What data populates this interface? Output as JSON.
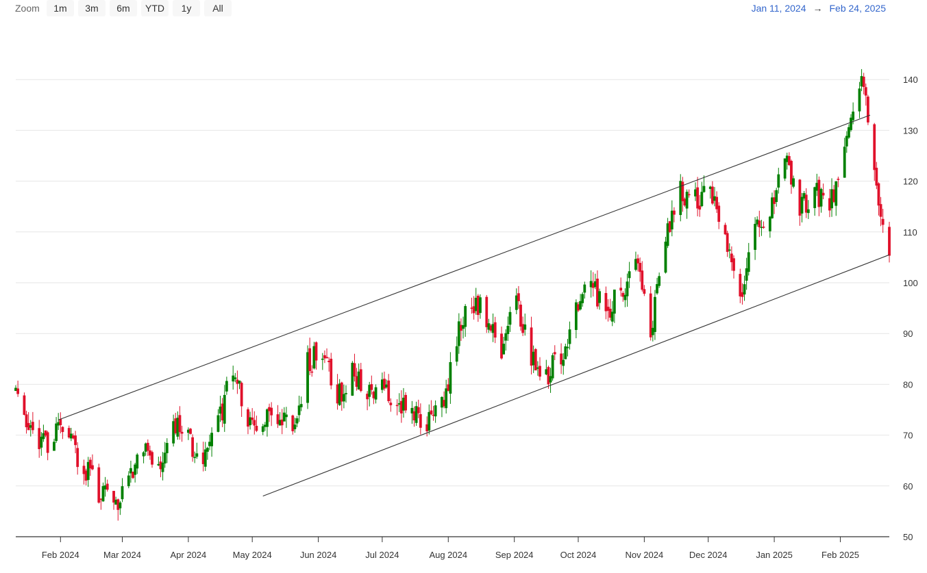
{
  "toolbar": {
    "zoom_label": "Zoom",
    "buttons": [
      "1m",
      "3m",
      "6m",
      "YTD",
      "1y",
      "All"
    ],
    "range_from": "Jan 11, 2024",
    "range_arrow": "→",
    "range_to": "Feb 24, 2025"
  },
  "colors": {
    "up": "#008000",
    "down": "#e0102a",
    "grid": "#e6e6e6",
    "axis": "#333333",
    "trend": "#333333"
  },
  "chart_data": {
    "type": "candlestick",
    "title": "",
    "x_range": [
      "2024-01-11",
      "2025-02-24"
    ],
    "ylim": [
      50,
      150
    ],
    "y_ticks": [
      50,
      60,
      70,
      80,
      90,
      100,
      110,
      120,
      130,
      140
    ],
    "x_ticks": [
      {
        "date": "2024-02-01",
        "label": "Feb 2024"
      },
      {
        "date": "2024-03-01",
        "label": "Mar 2024"
      },
      {
        "date": "2024-04-01",
        "label": "Apr 2024"
      },
      {
        "date": "2024-05-01",
        "label": "May 2024"
      },
      {
        "date": "2024-06-01",
        "label": "Jun 2024"
      },
      {
        "date": "2024-07-01",
        "label": "Jul 2024"
      },
      {
        "date": "2024-08-01",
        "label": "Aug 2024"
      },
      {
        "date": "2024-09-01",
        "label": "Sep 2024"
      },
      {
        "date": "2024-10-01",
        "label": "Oct 2024"
      },
      {
        "date": "2024-11-01",
        "label": "Nov 2024"
      },
      {
        "date": "2024-12-01",
        "label": "Dec 2024"
      },
      {
        "date": "2025-01-01",
        "label": "Jan 2025"
      },
      {
        "date": "2025-02-01",
        "label": "Feb 2025"
      }
    ],
    "trend_lines": [
      {
        "from": {
          "date": "2024-01-31",
          "value": 73
        },
        "to": {
          "date": "2025-02-15",
          "value": 133
        }
      },
      {
        "from": {
          "date": "2024-05-06",
          "value": 58
        },
        "to": {
          "date": "2025-02-24",
          "value": 105.5
        }
      }
    ],
    "series_anchors": [
      [
        "2024-01-11",
        79
      ],
      [
        "2024-01-16",
        73
      ],
      [
        "2024-01-22",
        67
      ],
      [
        "2024-01-30",
        71
      ],
      [
        "2024-02-05",
        69
      ],
      [
        "2024-02-12",
        64
      ],
      [
        "2024-02-20",
        58
      ],
      [
        "2024-02-27",
        56.5
      ],
      [
        "2024-03-04",
        62
      ],
      [
        "2024-03-11",
        68
      ],
      [
        "2024-03-18",
        64
      ],
      [
        "2024-03-25",
        73
      ],
      [
        "2024-04-01",
        69
      ],
      [
        "2024-04-08",
        65
      ],
      [
        "2024-04-15",
        72
      ],
      [
        "2024-04-22",
        83
      ],
      [
        "2024-04-29",
        73
      ],
      [
        "2024-05-06",
        72
      ],
      [
        "2024-05-13",
        74
      ],
      [
        "2024-05-20",
        70
      ],
      [
        "2024-05-27",
        84
      ],
      [
        "2024-06-03",
        87
      ],
      [
        "2024-06-10",
        77
      ],
      [
        "2024-06-17",
        83
      ],
      [
        "2024-06-24",
        78
      ],
      [
        "2024-07-01",
        80
      ],
      [
        "2024-07-08",
        77
      ],
      [
        "2024-07-15",
        75
      ],
      [
        "2024-07-22",
        72
      ],
      [
        "2024-07-29",
        75
      ],
      [
        "2024-08-05",
        89
      ],
      [
        "2024-08-12",
        97
      ],
      [
        "2024-08-19",
        93
      ],
      [
        "2024-08-26",
        87
      ],
      [
        "2024-09-02",
        96
      ],
      [
        "2024-09-09",
        86
      ],
      [
        "2024-09-16",
        82
      ],
      [
        "2024-09-23",
        85
      ],
      [
        "2024-09-30",
        94
      ],
      [
        "2024-10-07",
        100
      ],
      [
        "2024-10-14",
        94
      ],
      [
        "2024-10-21",
        98
      ],
      [
        "2024-10-28",
        105
      ],
      [
        "2024-11-04",
        91
      ],
      [
        "2024-11-11",
        108
      ],
      [
        "2024-11-18",
        118
      ],
      [
        "2024-11-25",
        116
      ],
      [
        "2024-12-02",
        119
      ],
      [
        "2024-12-09",
        108
      ],
      [
        "2024-12-16",
        97
      ],
      [
        "2024-12-23",
        110
      ],
      [
        "2024-12-30",
        115
      ],
      [
        "2025-01-06",
        125
      ],
      [
        "2025-01-13",
        114
      ],
      [
        "2025-01-20",
        118
      ],
      [
        "2025-01-27",
        115
      ],
      [
        "2025-02-03",
        127
      ],
      [
        "2025-02-10",
        140
      ],
      [
        "2025-02-14",
        133
      ],
      [
        "2025-02-18",
        119
      ],
      [
        "2025-02-24",
        107
      ]
    ]
  }
}
